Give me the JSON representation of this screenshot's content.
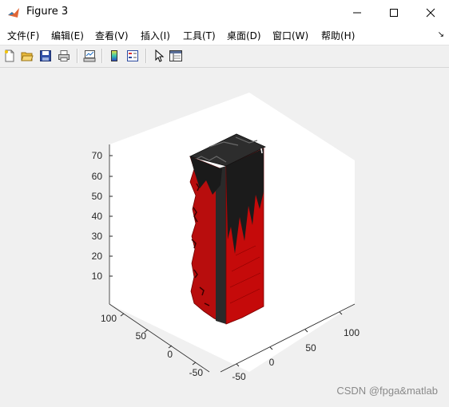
{
  "window": {
    "title": "Figure 3",
    "controls": {
      "minimize": "minimize",
      "maximize": "maximize",
      "close": "close"
    }
  },
  "menu": {
    "items": [
      "文件(F)",
      "编辑(E)",
      "查看(V)",
      "插入(I)",
      "工具(T)",
      "桌面(D)",
      "窗口(W)",
      "帮助(H)"
    ]
  },
  "toolbar": {
    "icons": [
      "new-figure-icon",
      "open-file-icon",
      "save-icon",
      "print-icon",
      "link-plot-icon",
      "insert-colorbar-icon",
      "insert-legend-icon",
      "edit-plot-icon",
      "property-inspector-icon"
    ]
  },
  "plot": {
    "z_ticks": [
      "10",
      "20",
      "30",
      "40",
      "50",
      "60",
      "70"
    ],
    "y_ticks": [
      "100",
      "50",
      "0",
      "-50"
    ],
    "x_ticks": [
      "-50",
      "0",
      "50",
      "100"
    ],
    "colors": {
      "surface_red": "#c00000",
      "surface_dark": "#1a1a1a",
      "axes_bg": "#ffffff",
      "figure_bg": "#f0f0f0"
    }
  },
  "watermark": "CSDN @fpga&matlab"
}
